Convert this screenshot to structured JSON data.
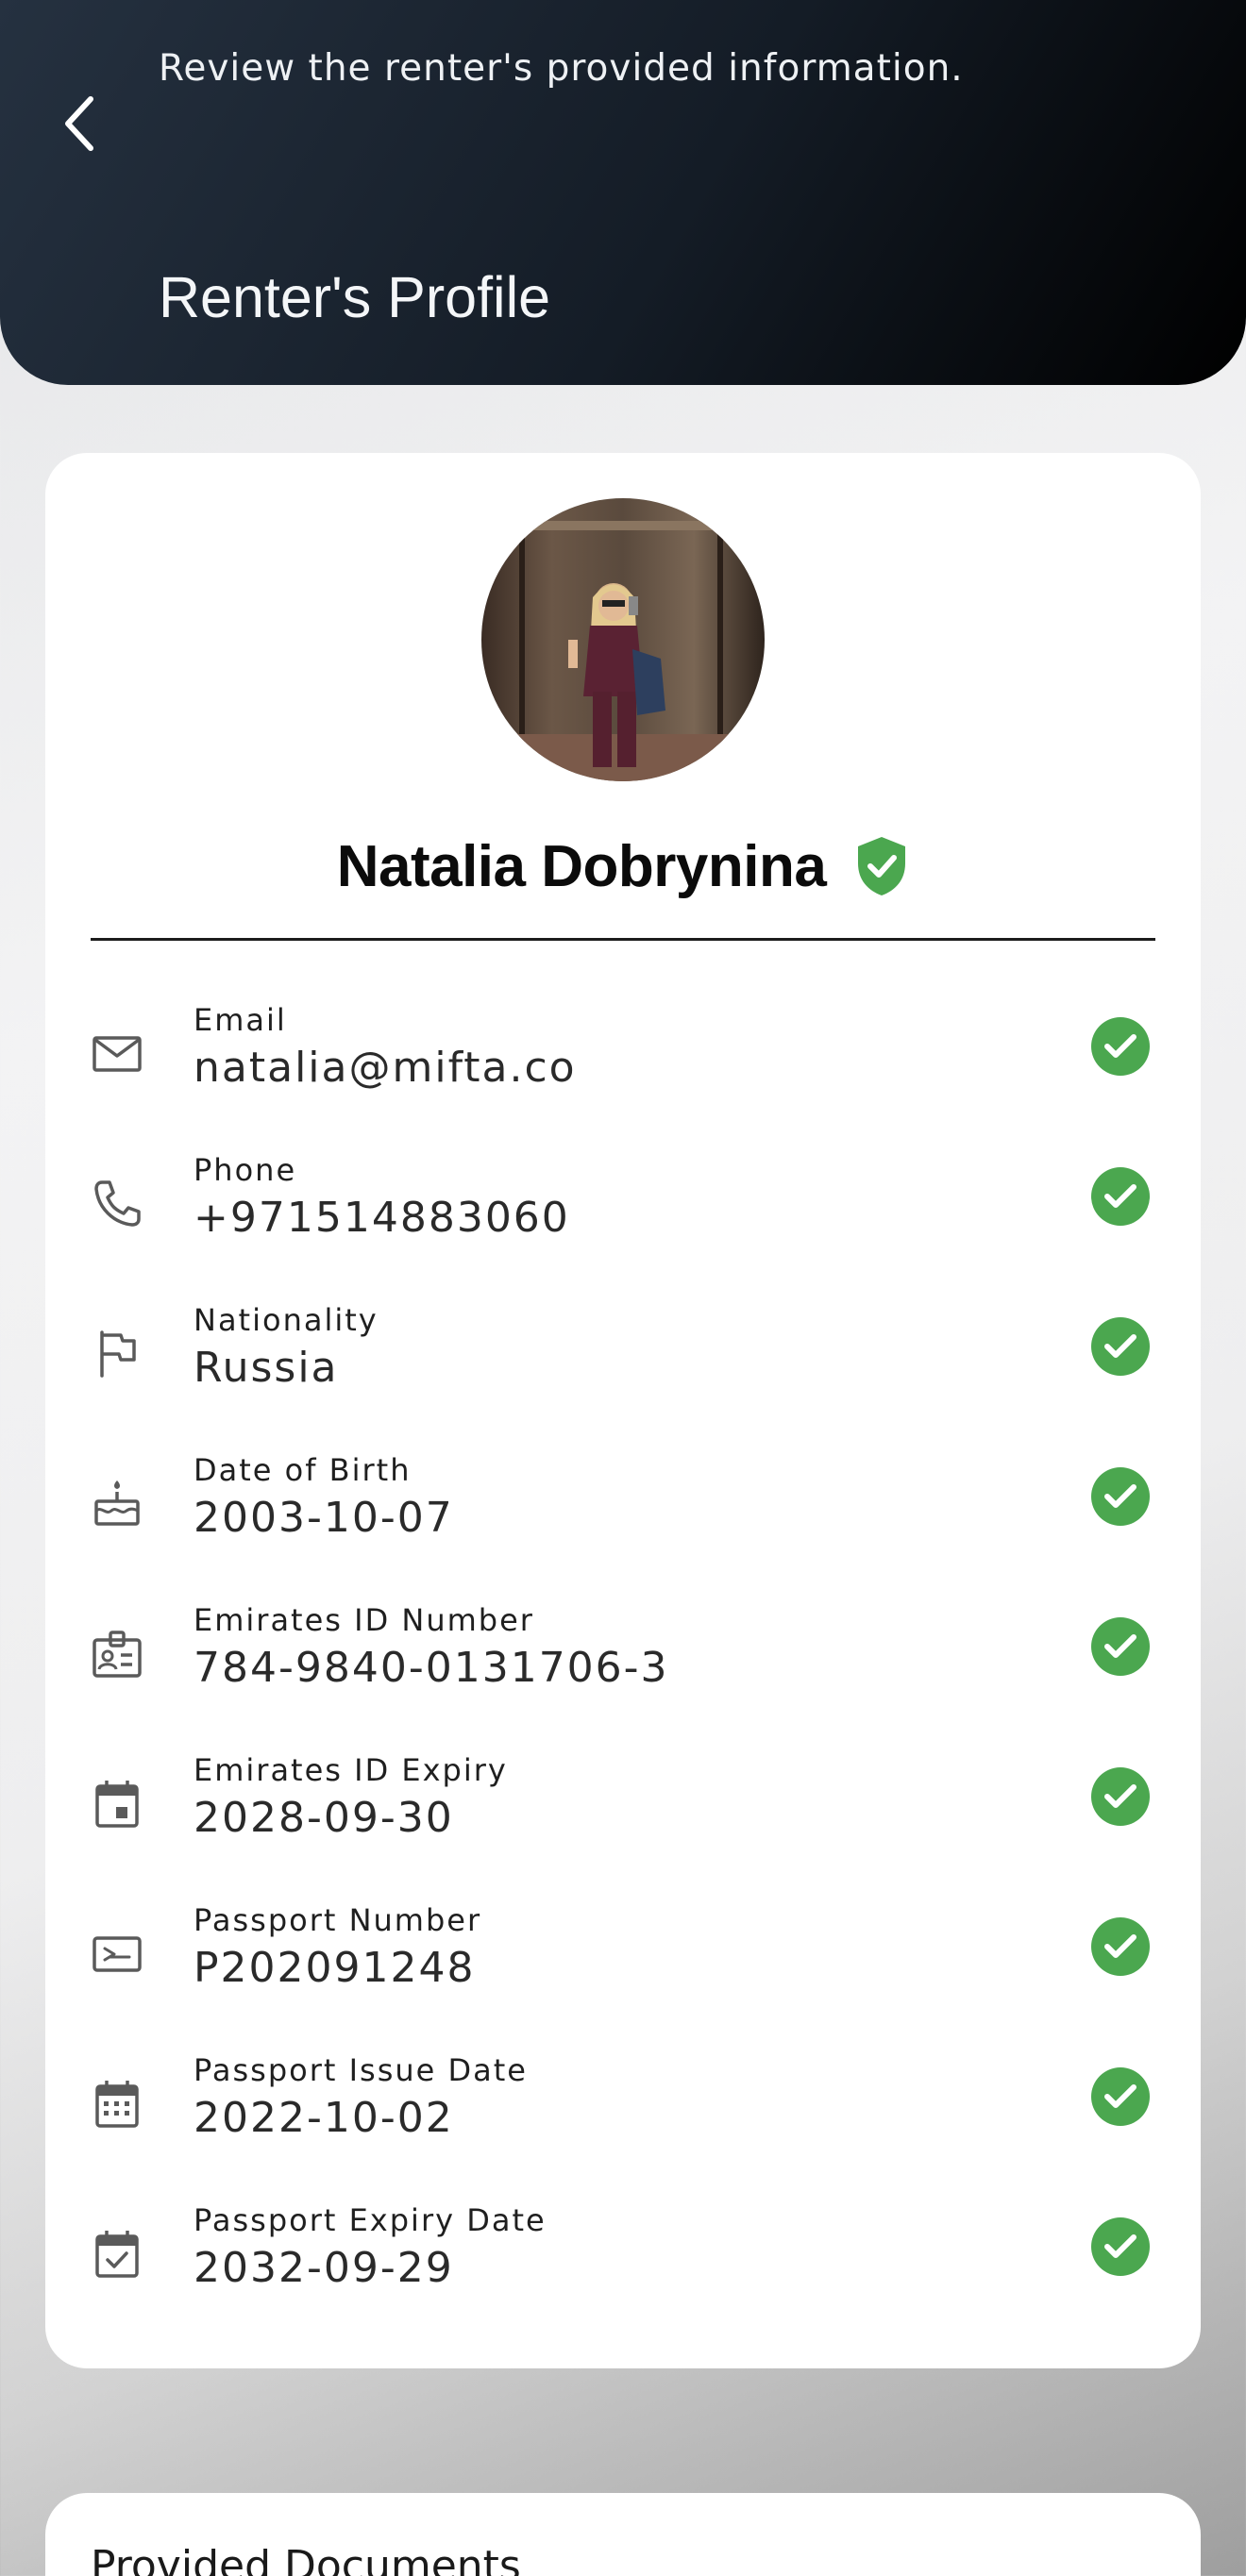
{
  "header": {
    "subtitle": "Review the renter's provided information.",
    "title": "Renter's Profile"
  },
  "profile": {
    "name": "Natalia Dobrynina",
    "verified_badge_color": "#4ba74f"
  },
  "fields": [
    {
      "icon": "mail-icon",
      "label": "Email",
      "value": "natalia@mifta.co"
    },
    {
      "icon": "phone-icon",
      "label": "Phone",
      "value": "+971514883060"
    },
    {
      "icon": "flag-icon",
      "label": "Nationality",
      "value": "Russia"
    },
    {
      "icon": "cake-icon",
      "label": "Date of Birth",
      "value": "2003-10-07"
    },
    {
      "icon": "id-badge-icon",
      "label": "Emirates ID Number",
      "value": "784-9840-0131706-3"
    },
    {
      "icon": "calendar-event-icon",
      "label": "Emirates ID Expiry",
      "value": "2028-09-30"
    },
    {
      "icon": "passport-icon",
      "label": "Passport Number",
      "value": "P202091248"
    },
    {
      "icon": "calendar-grid-icon",
      "label": "Passport Issue Date",
      "value": "2022-10-02"
    },
    {
      "icon": "calendar-check-icon",
      "label": "Passport Expiry Date",
      "value": "2032-09-29"
    }
  ],
  "documents": {
    "title": "Provided Documents"
  },
  "colors": {
    "check": "#4ba74f",
    "header_dark": "#141c26"
  }
}
